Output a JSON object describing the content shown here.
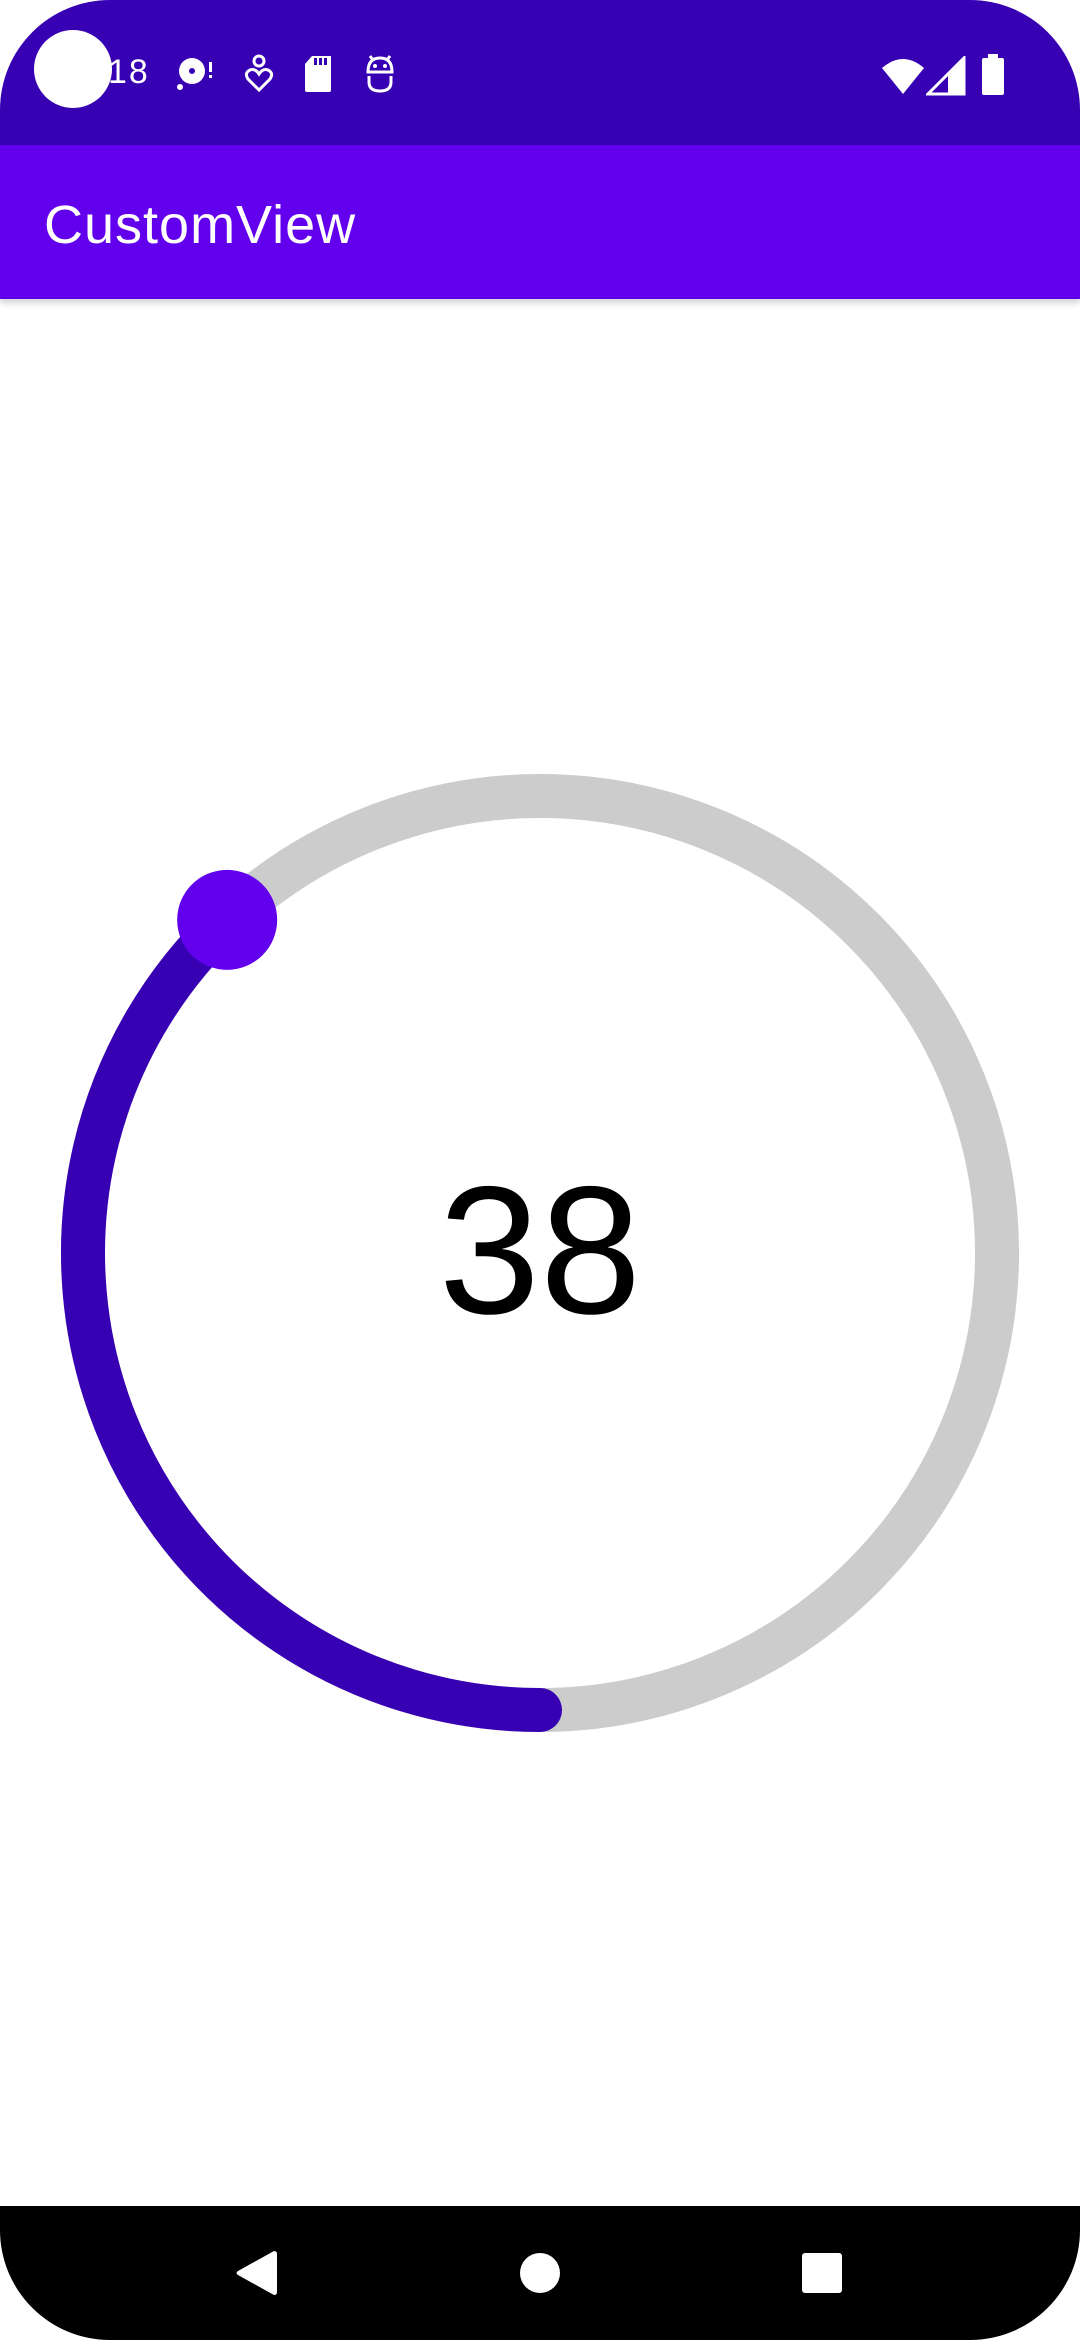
{
  "status_bar": {
    "time": "18",
    "notification_icons": [
      "disc-alert-icon",
      "accessibility-heart-icon",
      "sd-card-icon",
      "android-debug-icon"
    ],
    "system_icons": [
      "wifi-icon",
      "cell-signal-icon",
      "battery-icon"
    ]
  },
  "app_bar": {
    "title": "CustomView"
  },
  "dial": {
    "value": "38",
    "progress_fraction": 0.38,
    "colors": {
      "track": "#cccccc",
      "progress": "#3700b3",
      "thumb": "#6200ee"
    }
  },
  "nav_bar": {
    "buttons": [
      "back-icon",
      "home-icon",
      "recents-icon"
    ]
  }
}
